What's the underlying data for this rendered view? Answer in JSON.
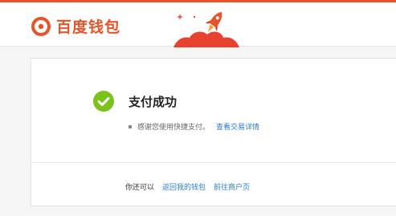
{
  "brand": {
    "name": "百度钱包",
    "accent": "#e8542a"
  },
  "result": {
    "title": "支付成功",
    "message": "感谢您使用快捷支付。",
    "detail_link": "查看交易详情",
    "status_color": "#7cc21a"
  },
  "footer": {
    "prompt": "你还可以",
    "links": [
      "返回我的钱包",
      "前往商户页"
    ]
  },
  "link_color": "#2a7ad0"
}
